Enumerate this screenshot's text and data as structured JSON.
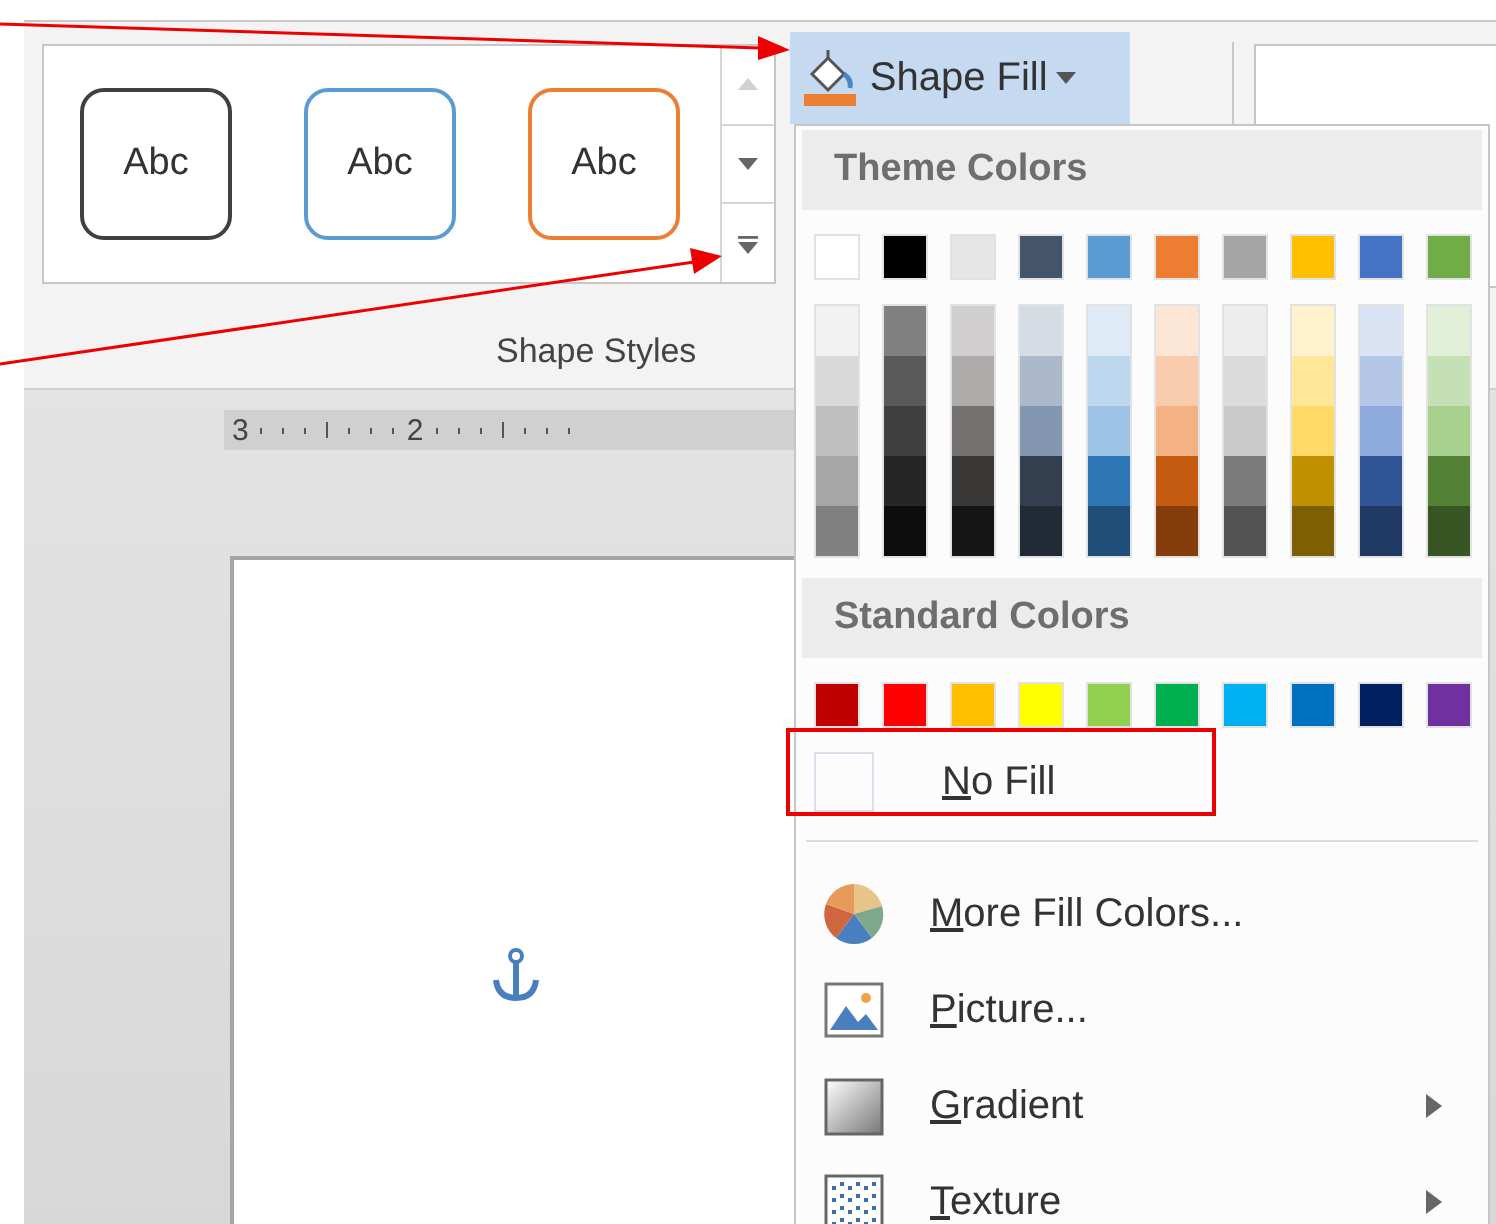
{
  "gallery": {
    "styles": [
      {
        "label": "Abc",
        "color": "#404040"
      },
      {
        "label": "Abc",
        "color": "#5b9bd5"
      },
      {
        "label": "Abc",
        "color": "#ed7d31"
      }
    ],
    "scroll_buttons": [
      {
        "kind": "up",
        "disabled": true
      },
      {
        "kind": "down",
        "disabled": false
      },
      {
        "kind": "more",
        "disabled": false
      }
    ],
    "group_label": "Shape Styles"
  },
  "ruler": {
    "labels": [
      "3",
      "2"
    ]
  },
  "shape_fill": {
    "label": "Shape Fill",
    "expanded": true,
    "color": "#ed7d31"
  },
  "menu": {
    "theme_header": "Theme Colors",
    "theme_colors": [
      {
        "color": "#ffffff",
        "shades": [
          {
            "color": "#f2f2f2"
          },
          {
            "color": "#d9d9d9"
          },
          {
            "color": "#bfbfbf"
          },
          {
            "color": "#a6a6a6"
          },
          {
            "color": "#808080"
          }
        ]
      },
      {
        "color": "#000000",
        "shades": [
          {
            "color": "#808080"
          },
          {
            "color": "#595959"
          },
          {
            "color": "#404040"
          },
          {
            "color": "#262626"
          },
          {
            "color": "#0d0d0d"
          }
        ]
      },
      {
        "color": "#e7e6e6",
        "shades": [
          {
            "color": "#d0cece"
          },
          {
            "color": "#aeabab"
          },
          {
            "color": "#767171"
          },
          {
            "color": "#3b3838"
          },
          {
            "color": "#171616"
          }
        ]
      },
      {
        "color": "#44546a",
        "shades": [
          {
            "color": "#d6dce4"
          },
          {
            "color": "#acb9ca"
          },
          {
            "color": "#8497b0"
          },
          {
            "color": "#333f4f"
          },
          {
            "color": "#222b35"
          }
        ]
      },
      {
        "color": "#5b9bd5",
        "shades": [
          {
            "color": "#deebf6"
          },
          {
            "color": "#bdd7ee"
          },
          {
            "color": "#9dc3e6"
          },
          {
            "color": "#2e75b5"
          },
          {
            "color": "#1f4e79"
          }
        ]
      },
      {
        "color": "#ed7d31",
        "shades": [
          {
            "color": "#fbe5d5"
          },
          {
            "color": "#f8cbad"
          },
          {
            "color": "#f4b183"
          },
          {
            "color": "#c55a11"
          },
          {
            "color": "#843c0b"
          }
        ]
      },
      {
        "color": "#a5a5a5",
        "shades": [
          {
            "color": "#ededed"
          },
          {
            "color": "#dbdbdb"
          },
          {
            "color": "#c9c9c9"
          },
          {
            "color": "#7b7b7b"
          },
          {
            "color": "#525252"
          }
        ]
      },
      {
        "color": "#ffc000",
        "shades": [
          {
            "color": "#fff2cc"
          },
          {
            "color": "#ffe699"
          },
          {
            "color": "#ffd966"
          },
          {
            "color": "#bf9000"
          },
          {
            "color": "#7f6000"
          }
        ]
      },
      {
        "color": "#4472c4",
        "shades": [
          {
            "color": "#dae3f3"
          },
          {
            "color": "#b4c7e7"
          },
          {
            "color": "#8faadc"
          },
          {
            "color": "#2f5597"
          },
          {
            "color": "#203864"
          }
        ]
      },
      {
        "color": "#70ad47",
        "shades": [
          {
            "color": "#e2f0d9"
          },
          {
            "color": "#c5e0b4"
          },
          {
            "color": "#a9d18e"
          },
          {
            "color": "#538135"
          },
          {
            "color": "#375623"
          }
        ]
      }
    ],
    "standard_header": "Standard Colors",
    "standard_colors": [
      {
        "color": "#c00000"
      },
      {
        "color": "#ff0000"
      },
      {
        "color": "#ffc000"
      },
      {
        "color": "#ffff00"
      },
      {
        "color": "#92d050"
      },
      {
        "color": "#00b050"
      },
      {
        "color": "#00b0f0"
      },
      {
        "color": "#0070c0"
      },
      {
        "color": "#002060"
      },
      {
        "color": "#7030a0"
      }
    ],
    "no_fill": {
      "label": "No Fill",
      "highlighted": true
    },
    "items": [
      {
        "kind": "more_colors",
        "label": "More Fill Colors...",
        "submenu": false
      },
      {
        "kind": "picture",
        "label": "Picture...",
        "submenu": false
      },
      {
        "kind": "gradient",
        "label": "Gradient",
        "submenu": true
      },
      {
        "kind": "texture",
        "label": "Texture",
        "submenu": true
      }
    ]
  }
}
